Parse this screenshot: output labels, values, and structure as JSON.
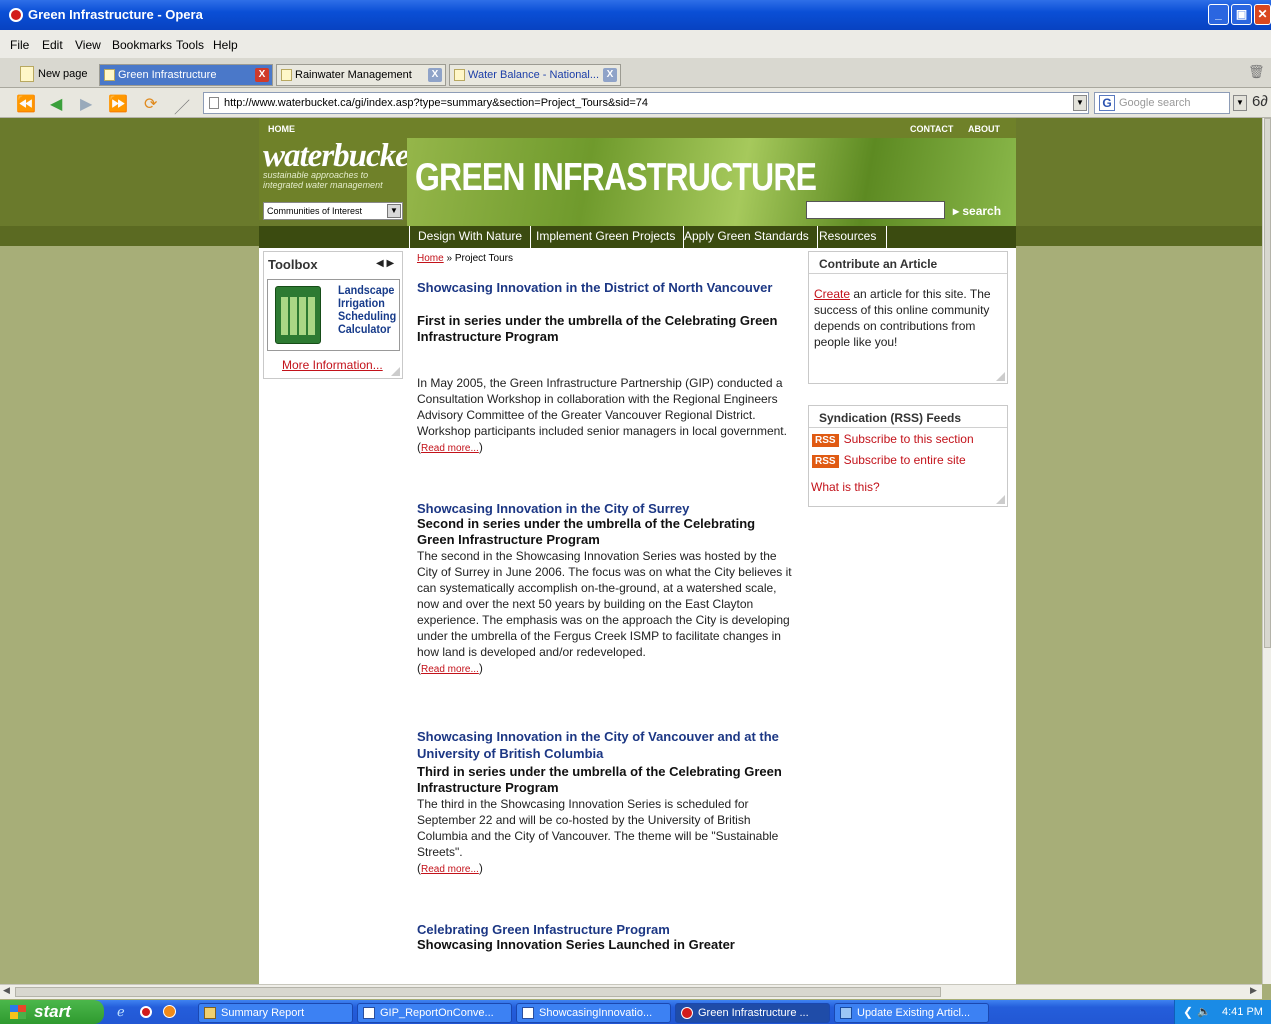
{
  "window": {
    "title": "Green Infrastructure - Opera"
  },
  "menu": [
    "File",
    "Edit",
    "View",
    "Bookmarks",
    "Tools",
    "Help"
  ],
  "tabs": {
    "new_page": "New page",
    "items": [
      "Green Infrastructure",
      "Rainwater Management",
      "Water Balance - National..."
    ]
  },
  "address": {
    "url": "http://www.waterbucket.ca/gi/index.asp?type=summary&section=Project_Tours&sid=74",
    "search_placeholder": "Google search"
  },
  "site": {
    "top_left": "HOME",
    "top_right": [
      "CONTACT",
      "ABOUT"
    ],
    "brand": {
      "name": "waterbucket",
      "tag1": "sustainable approaches to",
      "tag2": "integrated water management"
    },
    "communities": "Communities of Interest",
    "banner": "GREEN INFRASTRUCTURE",
    "search_label": "search",
    "nav": [
      "Design With Nature",
      "Implement Green Projects",
      "Apply Green Standards",
      "Resources"
    ]
  },
  "toolbox": {
    "title": "Toolbox",
    "tool_name": [
      "Landscape",
      "Irrigation",
      "Scheduling",
      "Calculator"
    ],
    "more": "More Information..."
  },
  "breadcrumb": {
    "home": "Home",
    "sep": " » ",
    "current": "Project Tours"
  },
  "articles": [
    {
      "title": "Showcasing Innovation in the District of North Vancouver",
      "subtitle": "First in series under the umbrella of the Celebrating Green Infrastructure Program",
      "body": "In May 2005, the Green Infrastructure Partnership (GIP) conducted a Consultation Workshop in collaboration with the Regional Engineers Advisory Committee of the Greater Vancouver Regional District. Workshop participants included senior managers in local government.",
      "read_more": "Read more..."
    },
    {
      "title": "Showcasing Innovation in the City of Surrey",
      "subtitle": "Second in series under the umbrella of the Celebrating Green Infrastructure Program",
      "body": "The second in the Showcasing Innovation Series was hosted by the City of Surrey in June 2006. The focus was on what the City believes it can systematically accomplish on-the-ground, at a watershed scale, now and over the next 50 years by building on the East Clayton experience. The emphasis was on the approach the City is developing under the umbrella of the Fergus Creek ISMP to facilitate changes in how land is developed and/or redeveloped.",
      "read_more": "Read more..."
    },
    {
      "title": "Showcasing Innovation in the City of Vancouver and at the University of British Columbia",
      "subtitle": "Third in series under the umbrella of the Celebrating Green Infrastructure Program",
      "body": "The third in the Showcasing Innovation Series is scheduled for September 22 and will be co-hosted by the University of British Columbia and the City of Vancouver. The theme will be \"Sustainable Streets\".",
      "read_more": "Read more..."
    },
    {
      "title": "Celebrating Green Infastructure Program",
      "subtitle": "Showcasing Innovation Series Launched in Greater"
    }
  ],
  "contribute": {
    "title": "Contribute an Article",
    "link": "Create",
    "text": " an article for this site. The success of this online community depends on contributions from people like you!"
  },
  "rss": {
    "title": "Syndication (RSS) Feeds",
    "badge": "RSS",
    "section": "Subscribe to this section",
    "site": "Subscribe to entire site",
    "what": "What is this?"
  },
  "taskbar": {
    "start": "start",
    "tasks": [
      "Summary Report",
      "GIP_ReportOnConve...",
      "ShowcasingInnovatio...",
      "Green Infrastructure ...",
      "Update Existing Articl..."
    ],
    "clock": "4:41 PM"
  }
}
